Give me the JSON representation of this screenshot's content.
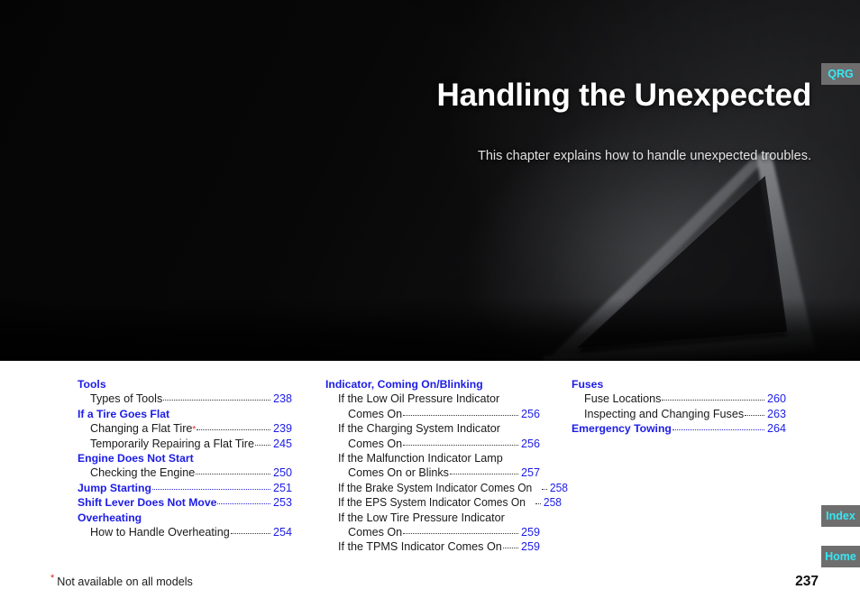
{
  "hero": {
    "title": "Handling the Unexpected",
    "subtitle": "This chapter explains how to handle unexpected troubles.",
    "image_alt": "warning-triangle-photo"
  },
  "side_tabs": [
    {
      "name": "qrg",
      "label": "QRG"
    },
    {
      "name": "index",
      "label": "Index"
    },
    {
      "name": "home",
      "label": "Home"
    }
  ],
  "toc": {
    "columns": [
      {
        "entries": [
          {
            "kind": "head",
            "label": "Tools",
            "page": ""
          },
          {
            "kind": "sub",
            "label": "Types of Tools",
            "page": "238"
          },
          {
            "kind": "head",
            "label": "If a Tire Goes Flat",
            "page": ""
          },
          {
            "kind": "sub-ast",
            "label": "Changing a Flat Tire",
            "page": "239"
          },
          {
            "kind": "sub",
            "label": "Temporarily Repairing a Flat Tire",
            "page": "245"
          },
          {
            "kind": "head",
            "label": "Engine Does Not Start",
            "page": ""
          },
          {
            "kind": "sub",
            "label": "Checking the Engine",
            "page": "250"
          },
          {
            "kind": "head-pg",
            "label": "Jump Starting",
            "page": "251"
          },
          {
            "kind": "head-pg",
            "label": "Shift Lever Does Not Move",
            "page": "253"
          },
          {
            "kind": "head",
            "label": "Overheating",
            "page": ""
          },
          {
            "kind": "sub",
            "label": "How to Handle Overheating",
            "page": "254"
          }
        ]
      },
      {
        "entries": [
          {
            "kind": "head",
            "label": "Indicator, Coming On/Blinking",
            "page": ""
          },
          {
            "kind": "wrap",
            "label": "If the Low Oil Pressure Indicator",
            "page": ""
          },
          {
            "kind": "wrap2",
            "label": "Comes On",
            "page": "256"
          },
          {
            "kind": "wrap",
            "label": "If the Charging System Indicator",
            "page": ""
          },
          {
            "kind": "wrap2",
            "label": "Comes On",
            "page": "256"
          },
          {
            "kind": "wrap",
            "label": "If the Malfunction Indicator Lamp",
            "page": ""
          },
          {
            "kind": "wrap2",
            "label": "Comes On or Blinks",
            "page": "257"
          },
          {
            "kind": "sub-cond",
            "label": "If the Brake System Indicator Comes On",
            "page": "258"
          },
          {
            "kind": "sub-cond",
            "label": "If the EPS System Indicator Comes On",
            "page": "258"
          },
          {
            "kind": "wrap",
            "label": "If the Low Tire Pressure Indicator",
            "page": ""
          },
          {
            "kind": "wrap2",
            "label": "Comes On",
            "page": "259"
          },
          {
            "kind": "sub",
            "label": "If the TPMS Indicator Comes On",
            "page": "259"
          }
        ]
      },
      {
        "entries": [
          {
            "kind": "head",
            "label": "Fuses",
            "page": ""
          },
          {
            "kind": "sub",
            "label": "Fuse Locations",
            "page": "260"
          },
          {
            "kind": "sub",
            "label": "Inspecting and Changing Fuses",
            "page": "263"
          },
          {
            "kind": "head-pg",
            "label": "Emergency Towing",
            "page": "264"
          }
        ]
      }
    ]
  },
  "footer": {
    "footnote_marker": "*",
    "footnote": "Not available on all models",
    "page_number": "237"
  },
  "colors": {
    "heading_blue": "#1c1ce6",
    "page_blue": "#1c1ce6",
    "asterisk_red": "#e02020",
    "tab_bg": "#6e6e6e",
    "tab_text": "#37e6f2"
  }
}
